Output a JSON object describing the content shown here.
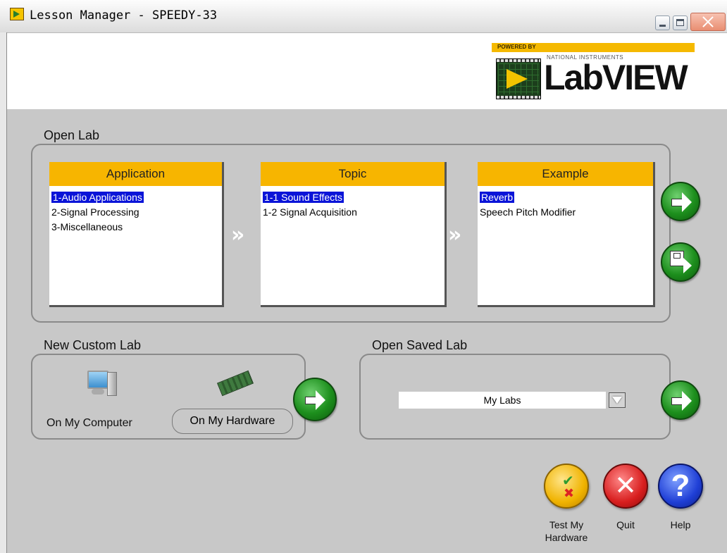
{
  "window": {
    "title": "Lesson Manager - SPEEDY-33"
  },
  "logo": {
    "powered_by": "POWERED BY",
    "company": "NATIONAL INSTRUMENTS",
    "product": "LabVIEW"
  },
  "open_lab": {
    "label": "Open Lab",
    "application": {
      "header": "Application",
      "items": [
        "1-Audio Applications",
        "2-Signal Processing",
        "3-Miscellaneous"
      ],
      "selected": "1-Audio Applications"
    },
    "topic": {
      "header": "Topic",
      "items": [
        "1-1 Sound Effects",
        "1-2 Signal Acquisition"
      ],
      "selected": "1-1 Sound Effects"
    },
    "example": {
      "header": "Example",
      "items": [
        "Reverb",
        "Speech Pitch Modifier"
      ],
      "selected": "Reverb"
    },
    "separator": "»"
  },
  "new_custom_lab": {
    "label": "New Custom Lab",
    "on_my_computer": "On My Computer",
    "on_my_hardware": "On My Hardware"
  },
  "open_saved_lab": {
    "label": "Open Saved Lab",
    "selected_value": "My Labs"
  },
  "bottom_buttons": {
    "test_line1": "Test My",
    "test_line2": "Hardware",
    "quit": "Quit",
    "help": "Help"
  },
  "colors": {
    "list_header": "#f7b500",
    "selection": "#0a14d8",
    "go_button": "#1d8f1d",
    "background": "#c8c8c8"
  }
}
